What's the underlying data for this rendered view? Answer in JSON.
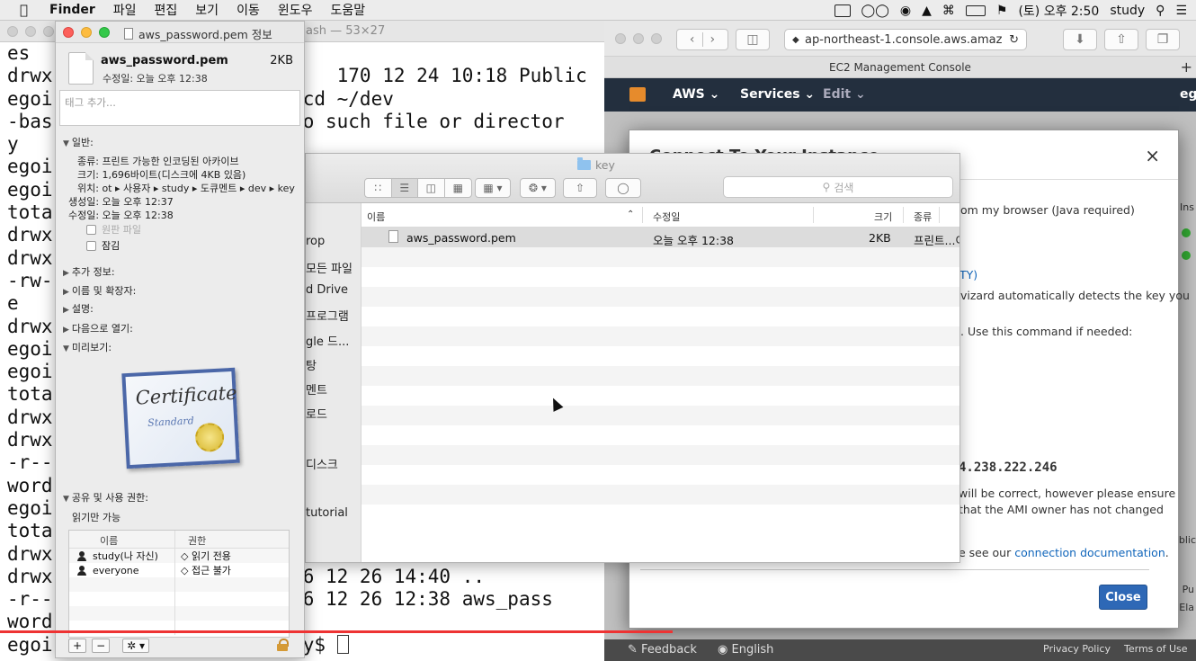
{
  "menubar": {
    "apple": "",
    "app": "Finder",
    "items": [
      "파일",
      "편집",
      "보기",
      "이동",
      "윈도우",
      "도움말"
    ],
    "right": {
      "date_time": "(토) 오후 2:50",
      "user": "study"
    }
  },
  "terminal": {
    "title": "ash — 53×27",
    "lines": [
      "es",
      "drwx                    f    170 12 24 10:18 Public",
      "egoi                  dy$ cd ~/dev",
      "-bas                  v: No such file or director",
      "y",
      "egoi",
      "egoi",
      "tota",
      "drwx",
      "drwx-",
      "-rw-",
      "e",
      "drwx",
      "egoi",
      "egoi",
      "tota",
      "drwx",
      "drwx",
      "-r--",
      "word",
      "egoi",
      "tota",
      "drwx",
      "drwx                    136 12 26 14:40 ..",
      "-r--                   1696 12 26 12:38 aws_pass",
      "word",
      "egoi                  study$ "
    ]
  },
  "info": {
    "title": "aws_password.pem 정보",
    "filename": "aws_password.pem",
    "size": "2KB",
    "modified": "수정일:  오늘 오후 12:38",
    "tags_placeholder": "태그 추가...",
    "general_label": "일반:",
    "kind": "종류: 프린트 가능한 인코딩된 아카이브",
    "size_detail": "크기: 1,696바이트(디스크에 4KB 있음)",
    "where": "위치: ot ▸ 사용자 ▸ study ▸ 도큐멘트 ▸ dev ▸ key",
    "created": "생성일: 오늘 오후 12:37",
    "modified_detail": "수정일: 오늘 오후 12:38",
    "stationery": "원판 파일",
    "locked": "잠김",
    "more_info": "추가 정보:",
    "name_ext": "이름 및 확장자:",
    "comments": "설명:",
    "open_with": "다음으로 열기:",
    "preview": "미리보기:",
    "cert_title": "Certificate",
    "cert_sub": "Standard",
    "sharing": "공유 및 사용 권한:",
    "access": "읽기만 가능",
    "perm_headers": [
      "이름",
      "권한"
    ],
    "perms": [
      {
        "name": "study(나 자신)",
        "priv": "◇ 읽기 전용"
      },
      {
        "name": "everyone",
        "priv": "◇ 접근 불가"
      }
    ],
    "add": "+",
    "remove": "−",
    "gear": "✲ ▾"
  },
  "finder": {
    "title": "key",
    "search_placeholder": "검색",
    "sidebar": [
      "rop",
      "모든 파일",
      "d Drive",
      "프로그램",
      "gle 드...",
      "탕",
      "멘트",
      "로드",
      "디스크",
      "tutorial"
    ],
    "columns": [
      "이름",
      "수정일",
      "크기",
      "종류"
    ],
    "files": [
      {
        "name": "aws_password.pem",
        "date": "오늘 오후 12:38",
        "size": "2KB",
        "kind": "프린트...이"
      }
    ]
  },
  "safari": {
    "url": "ap-northeast-1.console.aws.amaz",
    "tab_title": "EC2 Management Console",
    "aws_nav": [
      "AWS ⌄",
      "Services ⌄",
      "Edit ⌄"
    ],
    "nav_right": "ego",
    "modal": {
      "title": "Connect To Your Instance",
      "close": "×",
      "lines": [
        "om my browser (Java required)",
        "TY)",
        "vizard automatically detects the key you",
        ". Use this command if needed:",
        "4.238.222.246",
        "will be correct, however please ensure",
        "that the AMI owner has not changed"
      ],
      "doc_prefix": "e see our",
      "doc_link": "connection documentation",
      "doc_suffix": ".",
      "close_button": "Close"
    },
    "footer": {
      "feedback": "Feedback",
      "english": "English",
      "privacy": "Privacy Policy",
      "terms": "Terms of Use"
    },
    "side_labels": [
      "Ins",
      "Pu",
      "Ela",
      "blic"
    ]
  }
}
